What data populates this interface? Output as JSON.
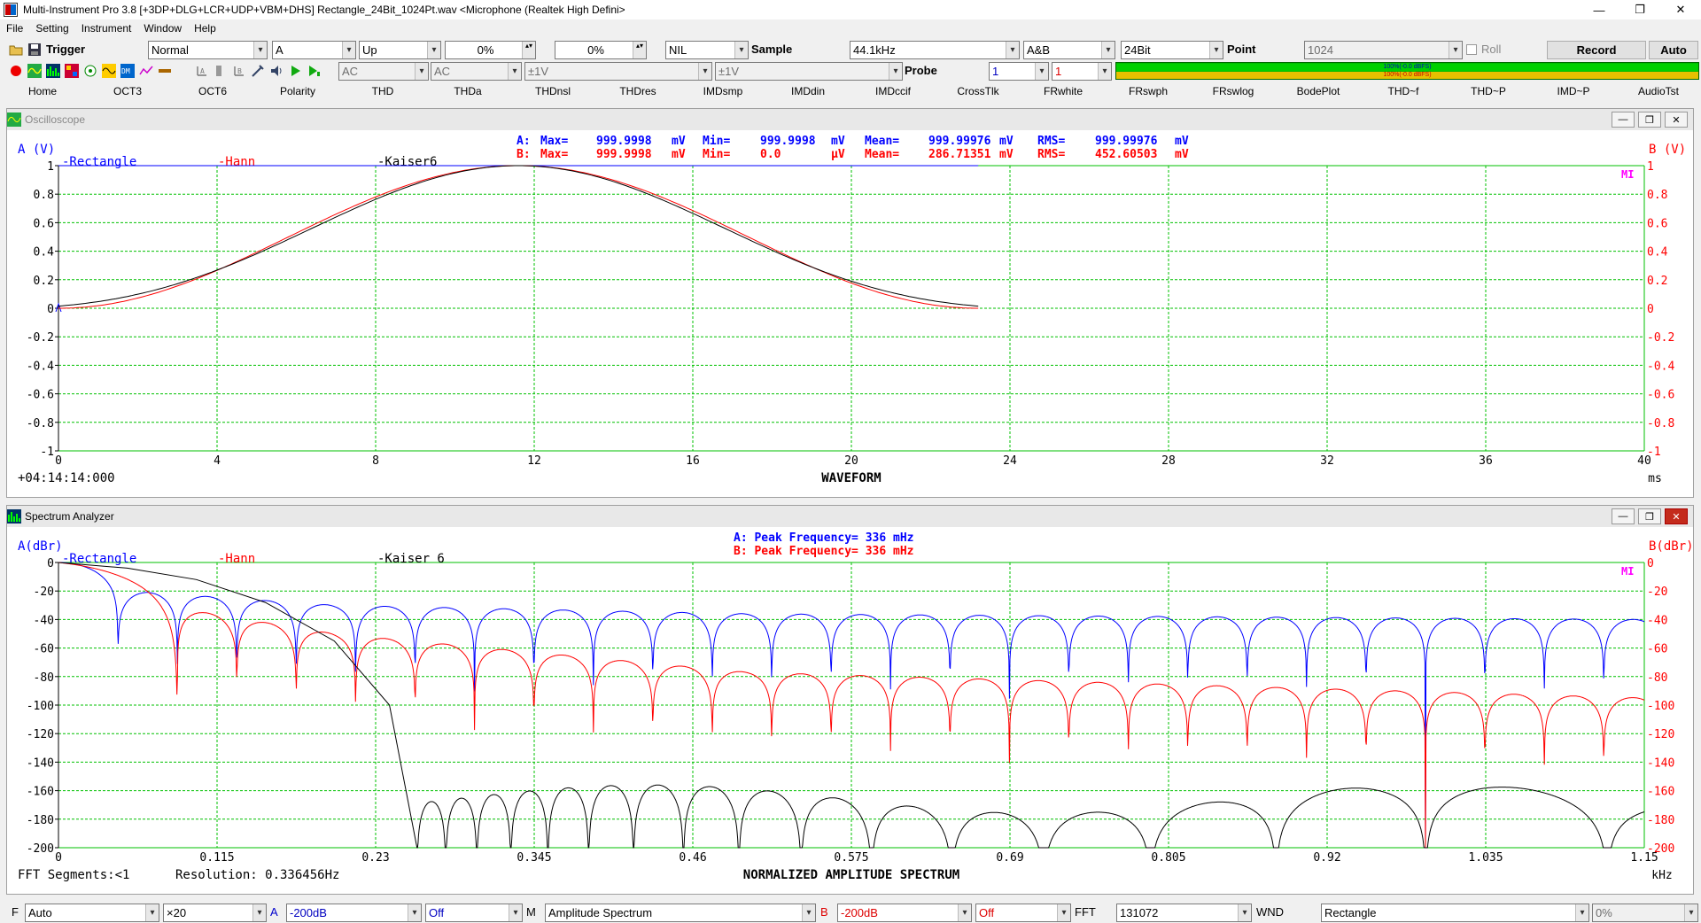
{
  "window": {
    "title": "Multi-Instrument Pro 3.8    [+3DP+DLG+LCR+UDP+VBM+DHS]    Rectangle_24Bit_1024Pt.wav    <Microphone (Realtek High Defini>"
  },
  "menu": [
    "File",
    "Setting",
    "Instrument",
    "Window",
    "Help"
  ],
  "toolbar1": {
    "trigger_label": "Trigger",
    "trigger_mode": "Normal",
    "trigger_channel": "A",
    "trigger_edge": "Up",
    "trigger_level": "0%",
    "trigger_delay": "0%",
    "nil": "NIL",
    "sample_label": "Sample",
    "sample_rate": "44.1kHz",
    "channels": "A&B",
    "bits": "24Bit",
    "point_label": "Point",
    "points": "1024",
    "roll_label": "Roll",
    "record_label": "Record",
    "auto_label": "Auto"
  },
  "toolbar2": {
    "coupling_a": "AC",
    "coupling_b": "AC",
    "range_a": "±1V",
    "range_b": "±1V",
    "probe_label": "Probe",
    "probe_a": "1",
    "probe_b": "1",
    "level_a_text": "100%(-0.0 dBFS)",
    "level_b_text": "100%(-0.0 dBFS)",
    "level_a": 1.0,
    "level_b": 1.0
  },
  "tabs": [
    "Home",
    "OCT3",
    "OCT6",
    "Polarity",
    "THD",
    "THDa",
    "THDnsl",
    "THDres",
    "IMDsmp",
    "IMDdin",
    "IMDccif",
    "CrossTlk",
    "FRwhite",
    "FRswph",
    "FRswlog",
    "BodePlot",
    "THD~f",
    "THD~P",
    "IMD~P",
    "AudioTst"
  ],
  "colors": {
    "grid": "#00c000",
    "chA": "#0000ff",
    "chB": "#ff0000",
    "third": "#000000",
    "magenta": "#ff00ff"
  },
  "oscilloscope": {
    "title": "Oscilloscope",
    "a_axis": "A (V)",
    "b_axis": "B (V)",
    "legend": [
      "-Rectangle",
      "-Hann",
      "-Kaiser6"
    ],
    "stats_a": [
      "A:",
      "Max=",
      "999.9998",
      "mV",
      "Min=",
      "999.9998",
      "mV",
      "Mean=",
      "999.99976",
      "mV",
      "RMS=",
      "999.99976",
      "mV"
    ],
    "stats_b": [
      "B:",
      "Max=",
      "999.9998",
      "mV",
      "Min=",
      "0.0",
      "µV",
      "Mean=",
      "286.71351",
      "mV",
      "RMS=",
      "452.60503",
      "mV"
    ],
    "time": "+04:14:14:000",
    "xlabel": "WAVEFORM",
    "xunit": "ms",
    "mi": "MI"
  },
  "spectrum": {
    "title": "Spectrum Analyzer",
    "a_axis": "A(dBr)",
    "b_axis": "B(dBr)",
    "legend": [
      "-Rectangle",
      "-Hann",
      "-Kaiser 6"
    ],
    "peak_a": "A: Peak Frequency=        336 mHz",
    "peak_b": "B: Peak Frequency=        336 mHz",
    "segments": "FFT Segments:<1",
    "resolution": "Resolution: 0.336456Hz",
    "xlabel": "NORMALIZED AMPLITUDE SPECTRUM",
    "xunit": "kHz",
    "mi": "MI"
  },
  "bottombar": {
    "f_label": "F",
    "f_value": "Auto",
    "zoom": "×20",
    "a_label": "A",
    "a_range": "-200dB",
    "a_off": "Off",
    "m_label": "M",
    "mode": "Amplitude Spectrum",
    "b_label": "B",
    "b_range": "-200dB",
    "b_off": "Off",
    "fft_label": "FFT",
    "fft_size": "131072",
    "wnd_label": "WND",
    "window": "Rectangle",
    "percent": "0%"
  },
  "chart_data": [
    {
      "type": "line",
      "title": "",
      "xlabel": "WAVEFORM",
      "ylabel": "A (V)",
      "y2label": "B (V)",
      "xlim": [
        0,
        40
      ],
      "ylim": [
        -1,
        1
      ],
      "x_ticks": [
        "0",
        "4",
        "8",
        "12",
        "16",
        "20",
        "24",
        "28",
        "32",
        "36",
        "40"
      ],
      "y_ticks": [
        "1",
        "0.8",
        "0.6",
        "0.4",
        "0.2",
        "0",
        "-0.2",
        "-0.4",
        "-0.6",
        "-0.8",
        "-1"
      ],
      "grid": true,
      "series": [
        {
          "name": "Rectangle",
          "color": "#0000ff",
          "x": [
            0,
            23.2
          ],
          "y": [
            1,
            1
          ]
        },
        {
          "name": "Hann",
          "color": "#ff0000",
          "x": [
            0,
            2,
            4,
            6,
            8,
            10,
            11.6,
            13,
            15,
            17,
            19,
            21,
            23.2
          ],
          "y": [
            0,
            0.07,
            0.26,
            0.52,
            0.78,
            0.95,
            1,
            0.96,
            0.79,
            0.54,
            0.28,
            0.09,
            0
          ]
        },
        {
          "name": "Kaiser6",
          "color": "#000000",
          "x": [
            0,
            2,
            4,
            5,
            6,
            7,
            8,
            9,
            10,
            11,
            11.6,
            12,
            13,
            14,
            15,
            16,
            17,
            18,
            19,
            20,
            21,
            23.2
          ],
          "y": [
            0,
            0,
            0.01,
            0.03,
            0.07,
            0.16,
            0.3,
            0.51,
            0.73,
            0.93,
            1,
            0.99,
            0.89,
            0.71,
            0.5,
            0.31,
            0.16,
            0.07,
            0.03,
            0.01,
            0,
            0
          ]
        }
      ]
    },
    {
      "type": "line",
      "title": "",
      "xlabel": "NORMALIZED AMPLITUDE SPECTRUM",
      "ylabel": "A(dBr)",
      "y2label": "B(dBr)",
      "xlim": [
        0,
        1.15
      ],
      "ylim": [
        -200,
        0
      ],
      "x_ticks": [
        "0",
        "0.115",
        "0.23",
        "0.345",
        "0.46",
        "0.575",
        "0.69",
        "0.805",
        "0.92",
        "1.035",
        "1.15"
      ],
      "y_ticks": [
        "0",
        "-20",
        "-40",
        "-60",
        "-80",
        "-100",
        "-120",
        "-140",
        "-160",
        "-180",
        "-200"
      ],
      "grid": true,
      "series": [
        {
          "name": "Rectangle",
          "color": "#0000ff",
          "null_spacing": 0.0431,
          "envelope_dB": [
            [
              0.065,
              -21
            ],
            [
              0.2,
              -30
            ],
            [
              0.5,
              -36
            ],
            [
              1.15,
              -40
            ]
          ]
        },
        {
          "name": "Hann",
          "color": "#ff0000",
          "null_spacing": 0.0431,
          "envelope_dB": [
            [
              0.086,
              -32
            ],
            [
              0.2,
              -50
            ],
            [
              0.5,
              -77
            ],
            [
              1.15,
              -95
            ]
          ]
        },
        {
          "name": "Kaiser 6",
          "color": "#000000",
          "x": [
            0,
            0.05,
            0.1,
            0.15,
            0.2,
            0.24,
            0.26
          ],
          "y": [
            0,
            -4,
            -12,
            -28,
            -55,
            -100,
            -200
          ],
          "sidelobe_floor_dB": -160
        }
      ]
    }
  ]
}
